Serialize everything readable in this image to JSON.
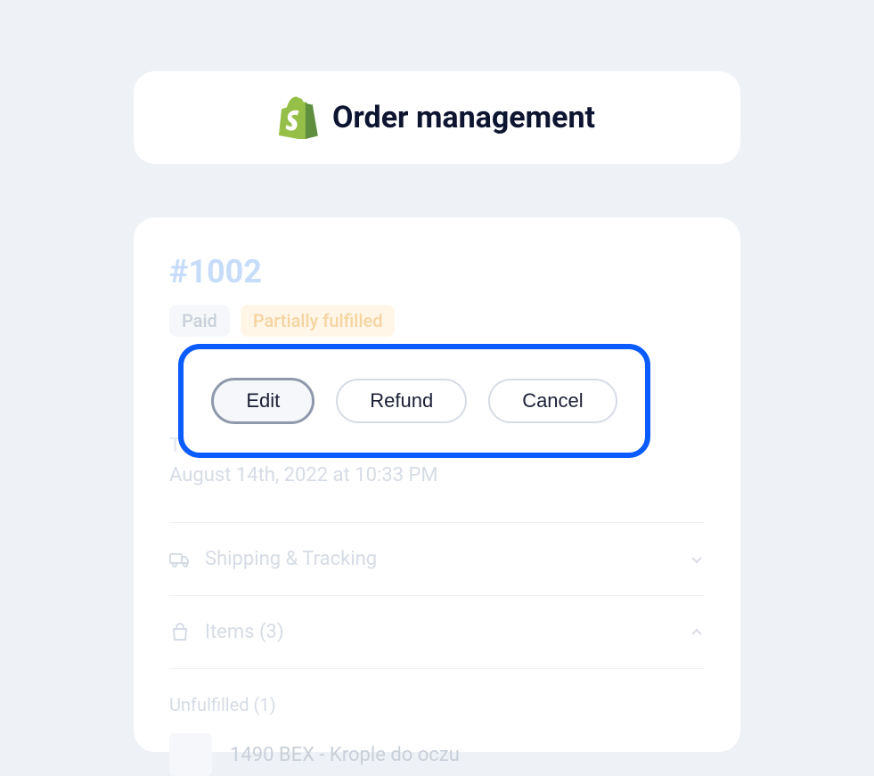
{
  "header": {
    "title": "Order management"
  },
  "order": {
    "number": "#1002",
    "badges": {
      "paid": "Paid",
      "partial": "Partially fulfilled"
    },
    "actions": {
      "edit": "Edit",
      "refund": "Refund",
      "cancel": "Cancel"
    },
    "partial_label": "T",
    "timestamp": "August 14th, 2022 at 10:33 PM",
    "sections": {
      "shipping": "Shipping & Tracking",
      "items": "Items (3)"
    },
    "unfulfilled_label": "Unfulfilled (1)",
    "product": {
      "name": "1490 BEX - Krople do oczu"
    }
  }
}
